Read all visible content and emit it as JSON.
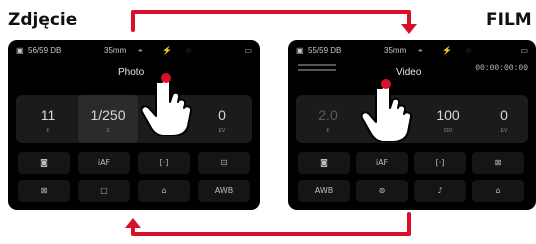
{
  "labels": {
    "left": "Zdjęcie",
    "right": "FILM"
  },
  "colors": {
    "arrow": "#d8102b",
    "screen": "#000000"
  },
  "photo": {
    "status": {
      "memory": "56/59 DB",
      "lens": "35mm"
    },
    "modes": {
      "current": "Photo"
    },
    "params": [
      {
        "value": "11",
        "unit": "F"
      },
      {
        "value": "1/250",
        "unit": "S"
      },
      {
        "value": "",
        "unit": ""
      },
      {
        "value": "0",
        "unit": "EV"
      }
    ],
    "row1_icons": [
      "camera-icon",
      "af-icon",
      "metering-icon",
      "white-balance-icon"
    ],
    "row2_icons": [
      "frame-icon",
      "square-icon",
      "drive-icon",
      "auto-wb-icon"
    ]
  },
  "video": {
    "status": {
      "memory": "55/59 DB",
      "lens": "35mm",
      "timecode": "00:00:00:00"
    },
    "modes": {
      "current": "Video"
    },
    "params": [
      {
        "value": "2.0",
        "unit": "F"
      },
      {
        "value": "",
        "unit": ""
      },
      {
        "value": "100",
        "unit": "ISO"
      },
      {
        "value": "0",
        "unit": "EV"
      }
    ],
    "row1_icons": [
      "camera-icon",
      "af-icon",
      "metering-icon",
      "picture-icon"
    ],
    "row2_icons": [
      "auto-wb-icon",
      "stabilizer-icon",
      "microphone-icon",
      "drive-icon"
    ]
  }
}
